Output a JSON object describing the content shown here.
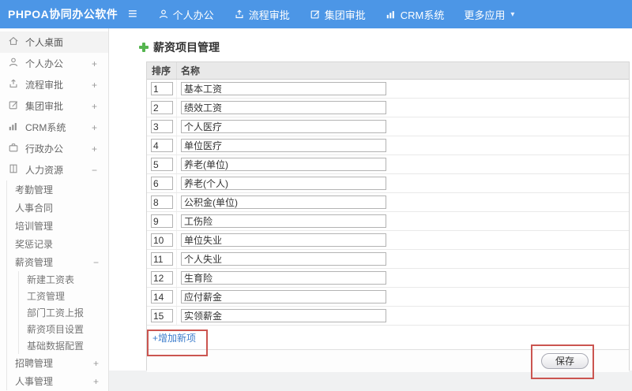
{
  "icons": {
    "hamburger": "≡",
    "caret_down": "▾"
  },
  "topbar": {
    "logo": "PHPOA协同办公软件",
    "nav": [
      {
        "label": "个人办公"
      },
      {
        "label": "流程审批"
      },
      {
        "label": "集团审批"
      },
      {
        "label": "CRM系统"
      },
      {
        "label": "更多应用"
      }
    ]
  },
  "sidebar": {
    "items": [
      {
        "label": "个人桌面",
        "exp": ""
      },
      {
        "label": "个人办公",
        "exp": "+"
      },
      {
        "label": "流程审批",
        "exp": "+"
      },
      {
        "label": "集团审批",
        "exp": "+"
      },
      {
        "label": "CRM系统",
        "exp": "+"
      },
      {
        "label": "行政办公",
        "exp": "+"
      },
      {
        "label": "人力资源",
        "exp": "−"
      }
    ],
    "hr_children": [
      {
        "label": "考勤管理"
      },
      {
        "label": "人事合同"
      },
      {
        "label": "培训管理"
      },
      {
        "label": "奖惩记录"
      }
    ],
    "salary_group": {
      "label": "薪资管理",
      "exp": "−"
    },
    "salary_children": [
      {
        "label": "新建工资表"
      },
      {
        "label": "工资管理"
      },
      {
        "label": "部门工资上报"
      },
      {
        "label": "薪资项目设置"
      },
      {
        "label": "基础数据配置"
      }
    ],
    "hr_children_tail": [
      {
        "label": "招聘管理",
        "exp": "+"
      },
      {
        "label": "人事管理",
        "exp": "+"
      }
    ]
  },
  "main": {
    "title": "薪资项目管理",
    "table": {
      "headers": [
        "排序",
        "名称"
      ],
      "rows": [
        {
          "order": "1",
          "name": "基本工资"
        },
        {
          "order": "2",
          "name": "绩效工资"
        },
        {
          "order": "3",
          "name": "个人医疗"
        },
        {
          "order": "4",
          "name": "单位医疗"
        },
        {
          "order": "5",
          "name": "养老(单位)"
        },
        {
          "order": "6",
          "name": "养老(个人)"
        },
        {
          "order": "8",
          "name": "公积金(单位)"
        },
        {
          "order": "9",
          "name": "工伤险"
        },
        {
          "order": "10",
          "name": "单位失业"
        },
        {
          "order": "11",
          "name": "个人失业"
        },
        {
          "order": "12",
          "name": "生育险"
        },
        {
          "order": "14",
          "name": "应付薪金"
        },
        {
          "order": "15",
          "name": "实领薪金"
        }
      ]
    },
    "add_link": "+增加新项",
    "save_label": "保存"
  },
  "colors": {
    "topbar_blue": "#4c96e6",
    "link_blue": "#3d7dcc",
    "annotation_red": "#cb5550",
    "title_plus_green": "#55b54f"
  }
}
